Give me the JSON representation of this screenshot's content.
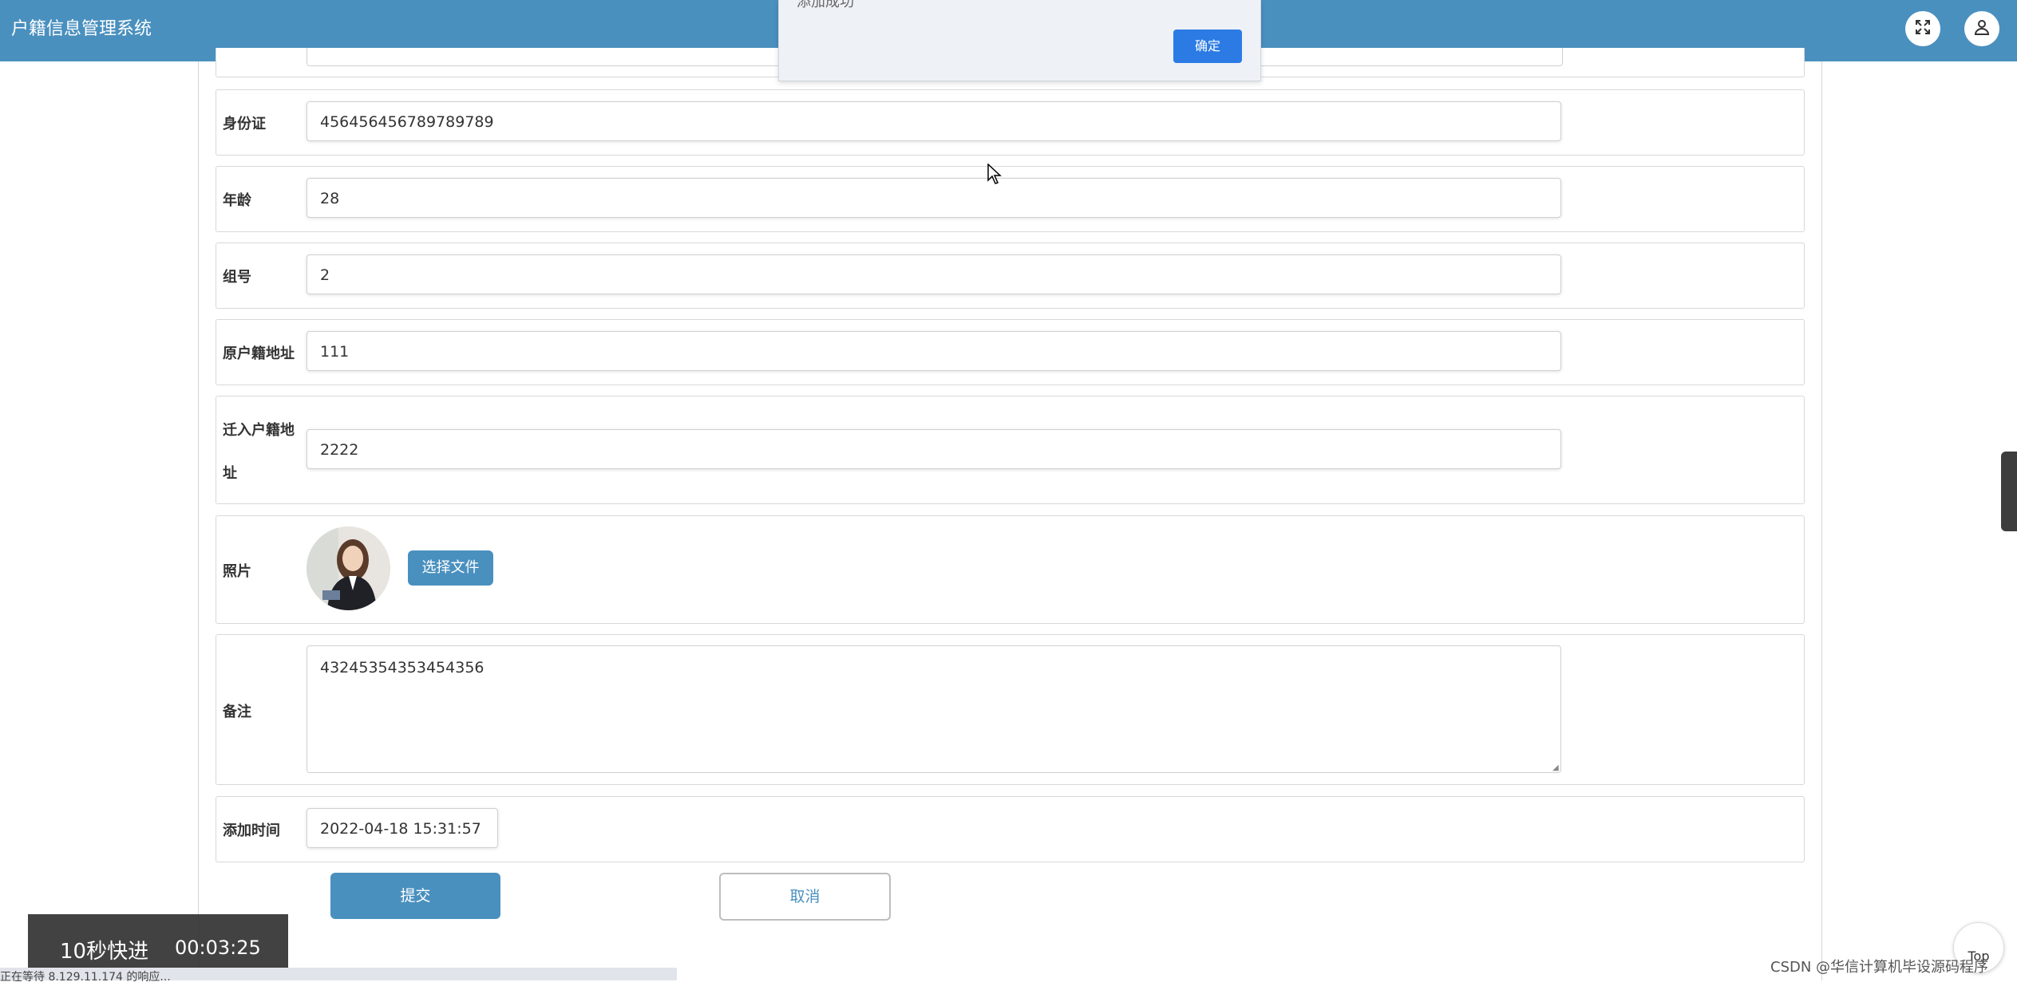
{
  "header": {
    "app_title": "户籍信息管理系统",
    "icons": [
      "fullscreen-icon",
      "user-icon"
    ]
  },
  "alert": {
    "message": "添加成功",
    "ok_label": "确定"
  },
  "form": {
    "id_card": {
      "label": "身份证",
      "value": "456456456789789789"
    },
    "age": {
      "label": "年龄",
      "value": "28"
    },
    "group_no": {
      "label": "组号",
      "value": "2"
    },
    "original_address": {
      "label": "原户籍地址",
      "value": "111"
    },
    "moved_in_address": {
      "label_line1": "迁入户籍地",
      "label_line2": "址",
      "value": "2222"
    },
    "photo": {
      "label": "照片",
      "choose_file_label": "选择文件"
    },
    "remark": {
      "label": "备注",
      "value": "43245354353454356"
    },
    "add_time": {
      "label": "添加时间",
      "value": "2022-04-18 15:31:57"
    }
  },
  "actions": {
    "submit_label": "提交",
    "cancel_label": "取消"
  },
  "video_overlay": {
    "fast_forward_label": "10秒快进",
    "time": "00:03:25"
  },
  "status_bar": {
    "text": "正在等待 8.129.11.174 的响应..."
  },
  "top_button_label": "Top",
  "watermark": "CSDN @华信计算机毕设源码程序",
  "colors": {
    "topbar": "#4a90bf",
    "primary_button": "#4a90bf",
    "alert_ok": "#2c7be5"
  }
}
